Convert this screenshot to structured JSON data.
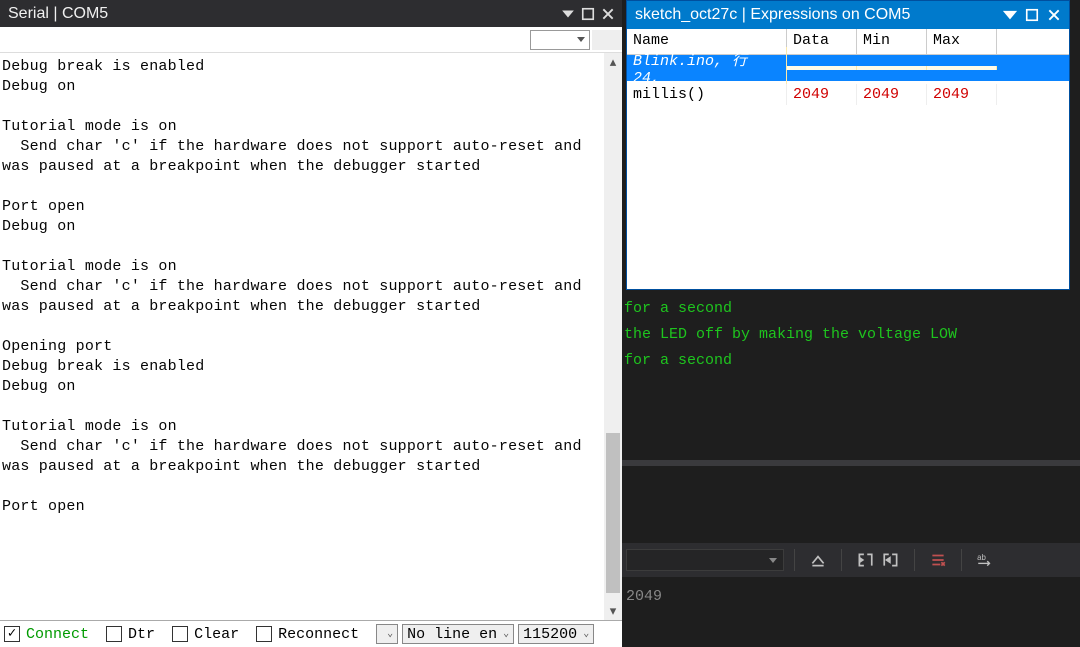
{
  "serial": {
    "title": "Serial | COM5",
    "output": "Debug break is enabled\nDebug on\n\nTutorial mode is on\n  Send char 'c' if the hardware does not support auto-reset and was paused at a breakpoint when the debugger started\n\nPort open\nDebug on\n\nTutorial mode is on\n  Send char 'c' if the hardware does not support auto-reset and was paused at a breakpoint when the debugger started\n\nOpening port\nDebug break is enabled\nDebug on\n\nTutorial mode is on\n  Send char 'c' if the hardware does not support auto-reset and was paused at a breakpoint when the debugger started\n\nPort open",
    "footer": {
      "connect_label": "Connect",
      "dtr_label": "Dtr",
      "clear_label": "Clear",
      "reconnect_label": "Reconnect",
      "line_ending": "No line en",
      "baud": "115200",
      "connect_checked": true
    }
  },
  "expressions": {
    "title": "sketch_oct27c | Expressions on COM5",
    "columns": {
      "name": "Name",
      "data": "Data",
      "min": "Min",
      "max": "Max"
    },
    "rows": [
      {
        "name": "Blink.ino, 行 24,",
        "data": "",
        "min": "",
        "max": "",
        "selected": true
      },
      {
        "name": "millis()",
        "data": "2049",
        "min": "2049",
        "max": "2049",
        "selected": false
      }
    ]
  },
  "code": {
    "lines": "for a second\nthe LED off by making the voltage LOW\nfor a second",
    "lower": "2049"
  }
}
